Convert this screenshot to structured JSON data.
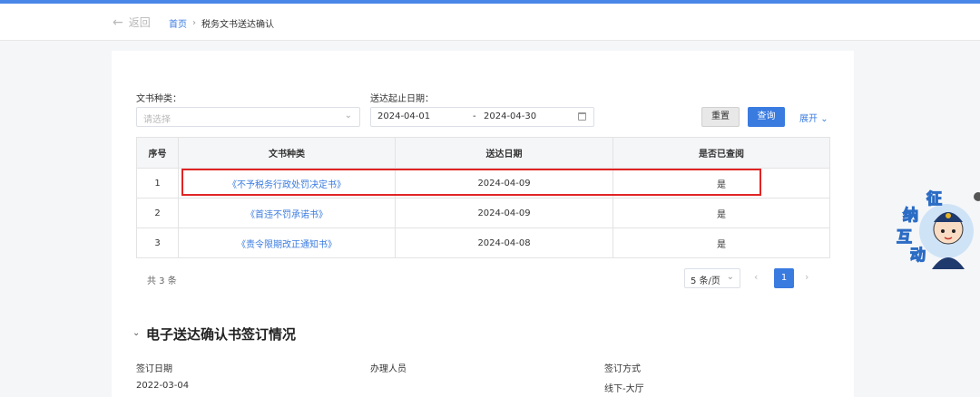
{
  "header": {
    "back_label": "返回",
    "breadcrumb_home": "首页",
    "breadcrumb_separator": "›",
    "breadcrumb_current": "税务文书送达确认"
  },
  "filters": {
    "doc_type_label": "文书种类：",
    "doc_type_placeholder": "请选择",
    "date_label": "送达起止日期：",
    "date_start": "2024-04-01",
    "date_separator": "-",
    "date_end": "2024-04-30"
  },
  "actions": {
    "reset": "重置",
    "query": "查询",
    "expand": "展开",
    "expand_chevron": "⌄"
  },
  "table": {
    "columns": [
      "序号",
      "文书种类",
      "送达日期",
      "是否已查阅"
    ],
    "rows": [
      {
        "index": "1",
        "doc": "《不予税务行政处罚决定书》",
        "date": "2024-04-09",
        "viewed": "是"
      },
      {
        "index": "2",
        "doc": "《首违不罚承诺书》",
        "date": "2024-04-09",
        "viewed": "是"
      },
      {
        "index": "3",
        "doc": "《责令限期改正通知书》",
        "date": "2024-04-08",
        "viewed": "是"
      }
    ]
  },
  "pagination": {
    "total": "共 3 条",
    "page_size": "5 条/页",
    "current_page": "1",
    "prev": "‹",
    "next": "›"
  },
  "section": {
    "title": "电子送达确认书签订情况",
    "fields": [
      {
        "label": "签订日期",
        "value": "2022-03-04"
      },
      {
        "label": "办理人员",
        "value": ""
      },
      {
        "label": "签订方式",
        "value": "线下-大厅"
      }
    ]
  },
  "mascot": {
    "chars": [
      "征",
      "纳",
      "互",
      "动"
    ]
  },
  "colors": {
    "accent": "#3a7be0",
    "highlight_border": "#e02424",
    "top_bar": "#4a86e8"
  }
}
